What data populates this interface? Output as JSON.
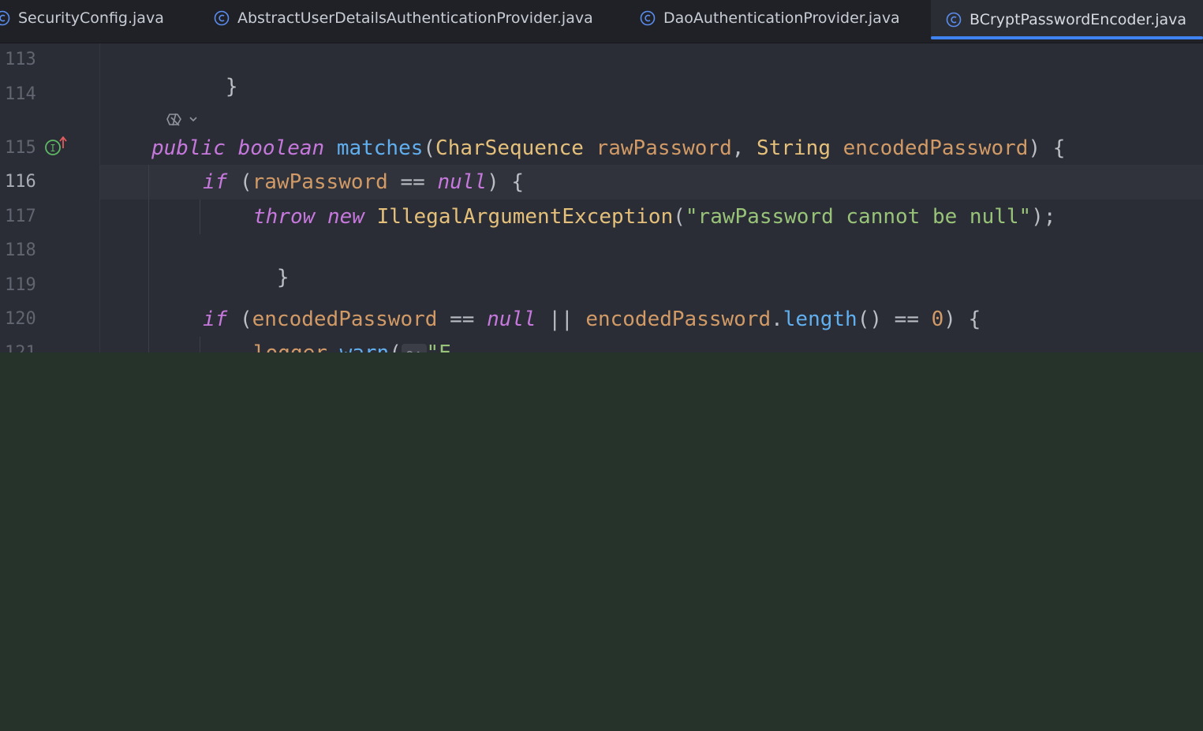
{
  "tabs": [
    {
      "label": "SecurityConfig.java",
      "active": false
    },
    {
      "label": "AbstractUserDetailsAuthenticationProvider.java",
      "active": false
    },
    {
      "label": "DaoAuthenticationProvider.java",
      "active": false
    },
    {
      "label": "BCryptPasswordEncoder.java",
      "active": true
    }
  ],
  "editor": {
    "current_line": "116",
    "line_numbers": [
      "113",
      "114",
      "115",
      "116",
      "117",
      "118",
      "119",
      "120",
      "121"
    ],
    "code": {
      "l113": {
        "brace": "}"
      },
      "l115": {
        "kw_public": "public",
        "kw_boolean": "boolean",
        "method": "matches",
        "paren_open": "(",
        "type_charseq": "CharSequence",
        "param_raw": "rawPassword",
        "comma": ",",
        "type_string": "String",
        "param_encoded": "encodedPassword",
        "paren_close_brace": ") {"
      },
      "l116": {
        "kw_if": "if",
        "paren_open": "(",
        "param": "rawPassword",
        "op": "==",
        "kw_null": "null",
        "close": ") {"
      },
      "l117": {
        "kw_throw": "throw",
        "kw_new": "new",
        "exception": "IllegalArgumentException",
        "paren_open": "(",
        "message": "\"rawPassword cannot be null\"",
        "close": ");"
      },
      "l118": {
        "brace": "}"
      },
      "l120": {
        "kw_if": "if",
        "paren_open": "(",
        "param1": "encodedPassword",
        "op1": "==",
        "kw_null": "null",
        "op_or": "||",
        "param2": "encodedPassword",
        "dot": ".",
        "method": "length",
        "call": "()",
        "op2": "==",
        "zero": "0",
        "close": ") {"
      },
      "l121": {
        "obj": "logger",
        "dot": ".",
        "method": "warn",
        "paren_open": "(",
        "hint": "o:",
        "string_start": "\"E"
      }
    },
    "icons": {
      "inlay_settings": "ai-assistant-icon",
      "implements_marker": "implements-method-icon",
      "chevron": "chevron-down-icon"
    }
  },
  "colors": {
    "keyword": "#c678dd",
    "function": "#61afef",
    "type": "#e5c07b",
    "parameter": "#d19a66",
    "string": "#98c379",
    "tab_underline": "#3f83f2",
    "lower_panel": "#25332b"
  }
}
